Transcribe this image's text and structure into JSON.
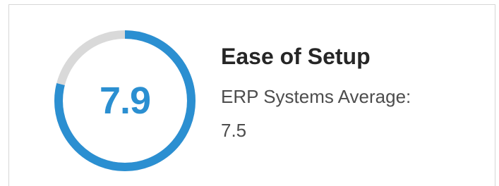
{
  "metric": {
    "score": "7.9",
    "score_fraction": 0.79,
    "title": "Ease of Setup",
    "average_label": "ERP Systems Average:",
    "average_value": "7.5"
  },
  "colors": {
    "gauge_fill": "#2b8fd1",
    "gauge_track": "#d9d9d9",
    "score_text": "#2b8fd1",
    "title_text": "#262626",
    "subtitle_text": "#4d4d4d"
  }
}
